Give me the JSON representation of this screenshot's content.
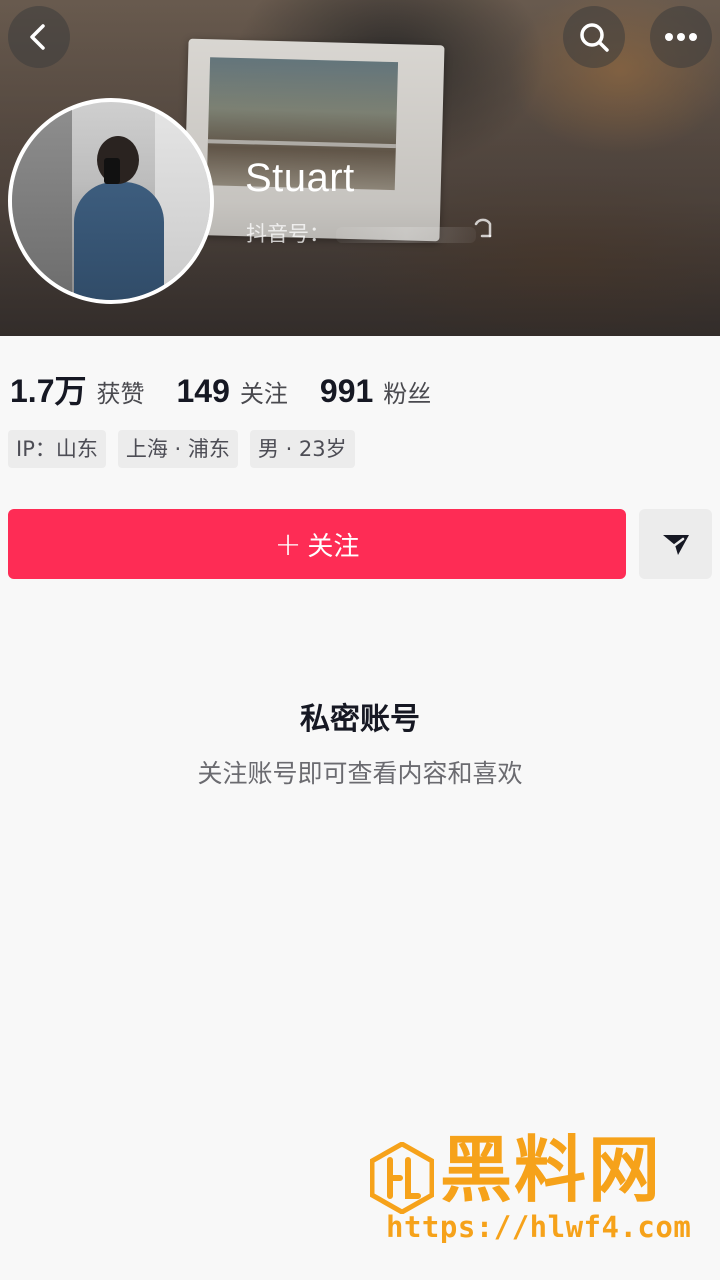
{
  "profile": {
    "username": "Stuart",
    "id_label": "抖音号：",
    "stats": [
      {
        "value": "1.7万",
        "label": "获赞"
      },
      {
        "value": "149",
        "label": "关注"
      },
      {
        "value": "991",
        "label": "粉丝"
      }
    ],
    "tags": [
      "IP：山东",
      "上海 · 浦东",
      "男 · 23岁"
    ]
  },
  "actions": {
    "follow_plus": "+",
    "follow_label": "关注"
  },
  "private": {
    "title": "私密账号",
    "subtitle": "关注账号即可查看内容和喜欢"
  },
  "watermark": {
    "text": "黑料网",
    "url": "https://hlwf4.com"
  },
  "icons": {
    "back": "chevron-left-icon",
    "search": "search-icon",
    "more": "more-icon",
    "share": "share-icon",
    "copy": "copy-icon"
  },
  "colors": {
    "accent": "#fe2c55",
    "watermark": "#f6a21a"
  }
}
